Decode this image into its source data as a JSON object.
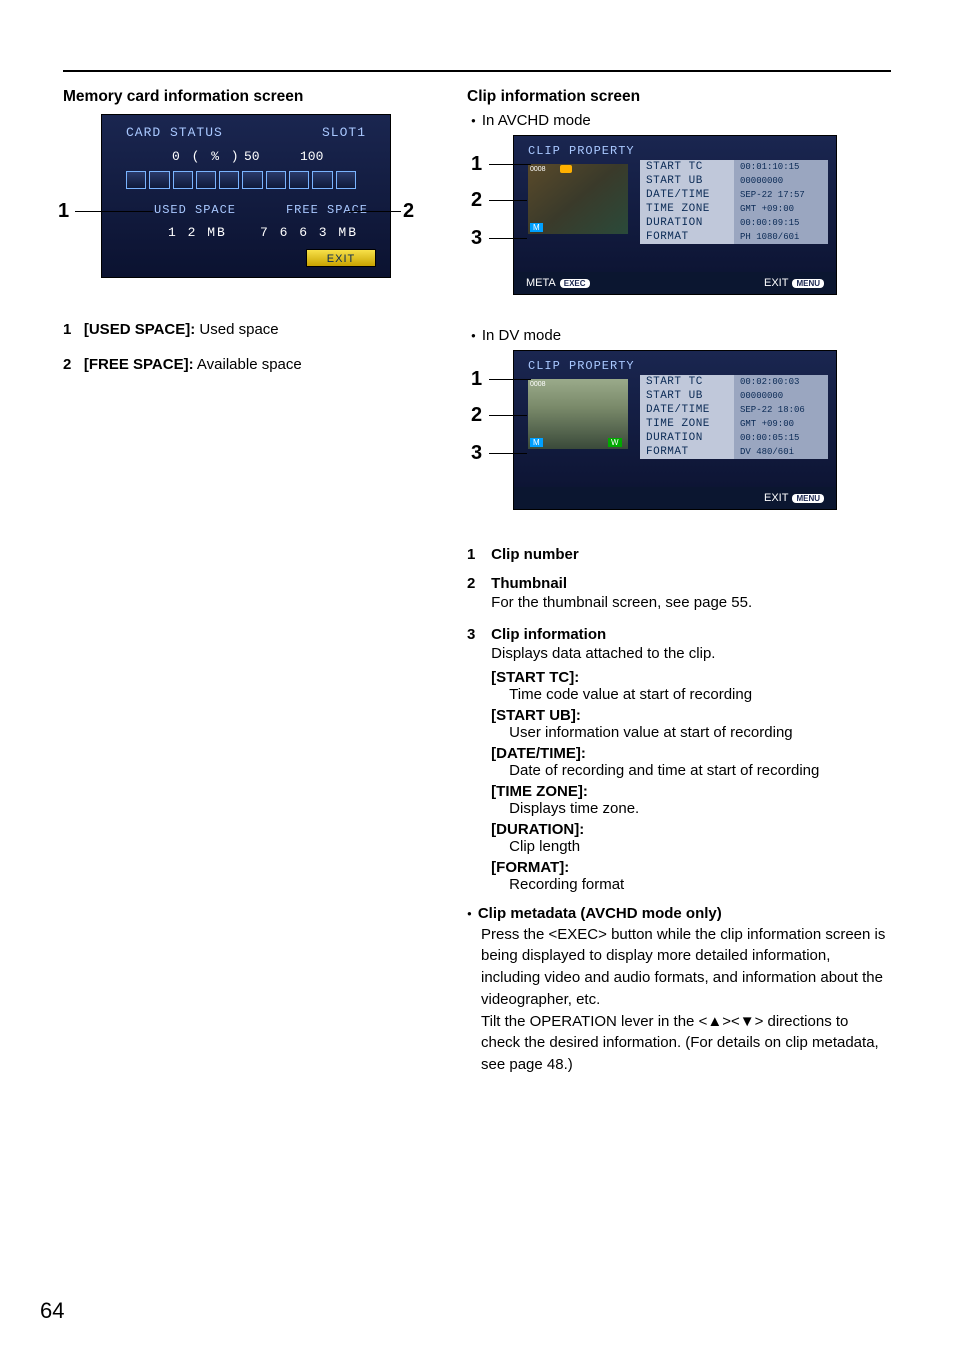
{
  "page_number": "64",
  "left": {
    "heading": "Memory card information screen",
    "card_status": "CARD STATUS",
    "slot": "SLOT1",
    "pct_label": "0 ( % )",
    "p50": "50",
    "p100": "100",
    "used_space_label": "USED SPACE",
    "used_space_val": "1 2 MB",
    "free_space_label": "FREE SPACE",
    "free_space_val": "7 6 6 3 MB",
    "exit": "EXIT",
    "callout_1": "1",
    "callout_2": "2",
    "list": {
      "i1_num": "1",
      "i1_key": "[USED SPACE]:",
      "i1_txt": " Used space",
      "i2_num": "2",
      "i2_key": "[FREE SPACE]:",
      "i2_txt": " Available space"
    }
  },
  "right": {
    "heading": "Clip information screen",
    "mode_avchd": "In AVCHD mode",
    "mode_dv": "In DV mode",
    "cp_title": "CLIP PROPERTY",
    "thumb_tag": "0008",
    "mk_m": "M",
    "mk_w": "W",
    "rows_av": [
      [
        "START TC",
        "00:01:10:15"
      ],
      [
        "START UB",
        "00000000"
      ],
      [
        "DATE/TIME",
        "SEP-22 17:57"
      ],
      [
        "TIME ZONE",
        "GMT +09:00"
      ],
      [
        "DURATION",
        "00:00:09:15"
      ],
      [
        "FORMAT",
        "PH 1080/60i"
      ]
    ],
    "rows_dv": [
      [
        "START TC",
        "00:02:00:03"
      ],
      [
        "START UB",
        "00000000"
      ],
      [
        "DATE/TIME",
        "SEP-22 18:06"
      ],
      [
        "TIME ZONE",
        "GMT +09:00"
      ],
      [
        "DURATION",
        "00:00:05:15"
      ],
      [
        "FORMAT",
        "DV 480/60i"
      ]
    ],
    "meta_btn": "META",
    "meta_pill": "EXEC",
    "exit_btn": "EXIT",
    "exit_pill": "MENU",
    "callout_1": "1",
    "callout_2": "2",
    "callout_3": "3",
    "info": {
      "i1_num": "1",
      "i1_title": "Clip number",
      "i2_num": "2",
      "i2_title": "Thumbnail",
      "i2_txt": "For the thumbnail screen, see page 55.",
      "i3_num": "3",
      "i3_title": "Clip information",
      "i3_txt": "Displays data attached to the clip.",
      "start_tc_k": "[START TC]:",
      "start_tc_v": "Time code value at start of recording",
      "start_ub_k": "[START UB]:",
      "start_ub_v": "User information value at start of recording",
      "date_k": "[DATE/TIME]:",
      "date_v": "Date of recording and time at start of recording",
      "tz_k": "[TIME ZONE]:",
      "tz_v": "Displays time zone.",
      "dur_k": "[DURATION]:",
      "dur_v": "Clip length",
      "fmt_k": "[FORMAT]:",
      "fmt_v": "Recording format"
    },
    "meta": {
      "title": "Clip metadata (AVCHD mode only)",
      "p1": "Press the <EXEC> button while the clip information screen is being displayed to display more detailed information, including video and audio formats, and information about the videographer, etc.",
      "p2a": "Tilt the OPERATION lever in the <",
      "up": "▲",
      "mid": "><",
      "down": "▼",
      "p2b": "> directions to check the desired information. (For details on clip metadata, see page 48.)"
    }
  }
}
